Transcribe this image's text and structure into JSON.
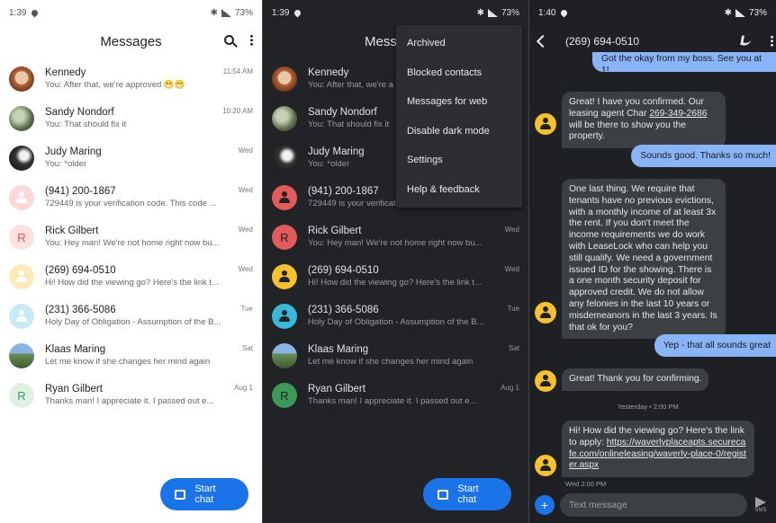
{
  "panel1": {
    "status": {
      "time": "1:39",
      "battery": "73%"
    },
    "title": "Messages",
    "fab_label": "Start chat",
    "conversations": [
      {
        "name": "Kennedy",
        "snippet": "You: After that, we're approved 😁😁",
        "time": "11:54 AM",
        "avatar": "photo1"
      },
      {
        "name": "Sandy Nondorf",
        "snippet": "You: That should fix it",
        "time": "10:20 AM",
        "avatar": "photo2"
      },
      {
        "name": "Judy Maring",
        "snippet": "You: *older",
        "time": "Wed",
        "avatar": "photo3"
      },
      {
        "name": "(941) 200-1867",
        "snippet": "729449 is your verification code. This code ...",
        "time": "Wed",
        "avatar": "person-red"
      },
      {
        "name": "Rick Gilbert",
        "snippet": "You: Hey man! We're not home right now bu...",
        "time": "Wed",
        "avatar": "letter-R-red",
        "letter": "R"
      },
      {
        "name": "(269) 694-0510",
        "snippet": "Hi! How did the viewing go? Here's the link t...",
        "time": "Wed",
        "avatar": "person-yellow"
      },
      {
        "name": "(231) 366-5086",
        "snippet": "Holy Day of Obligation - Assumption of the B...",
        "time": "Tue",
        "avatar": "person-cyan"
      },
      {
        "name": "Klaas Maring",
        "snippet": "Let me know if she changes her mind again",
        "time": "Sat",
        "avatar": "photo4"
      },
      {
        "name": "Ryan Gilbert",
        "snippet": "Thanks man! I appreciate it. I passed out e...",
        "time": "Aug 1",
        "avatar": "letter-R-green",
        "letter": "R"
      }
    ]
  },
  "panel2": {
    "status": {
      "time": "1:39",
      "battery": "73%"
    },
    "title": "Messa",
    "fab_label": "Start chat",
    "menu": [
      "Archived",
      "Blocked contacts",
      "Messages for web",
      "Disable dark mode",
      "Settings",
      "Help & feedback"
    ],
    "conversations": [
      {
        "name": "Kennedy",
        "snippet": "You: After that, we're a",
        "time": ""
      },
      {
        "name": "Sandy Nondorf",
        "snippet": "You: That should fix it",
        "time": ""
      },
      {
        "name": "Judy Maring",
        "snippet": "You: *older",
        "time": ""
      },
      {
        "name": "(941) 200-1867",
        "snippet": "729449 is your verification code. This code ...",
        "time": ""
      },
      {
        "name": "Rick Gilbert",
        "snippet": "You: Hey man! We're not home right now bu...",
        "time": "Wed",
        "letter": "R"
      },
      {
        "name": "(269) 694-0510",
        "snippet": "Hi! How did the viewing go? Here's the link t...",
        "time": "Wed"
      },
      {
        "name": "(231) 366-5086",
        "snippet": "Holy Day of Obligation - Assumption of the B...",
        "time": "Tue"
      },
      {
        "name": "Klaas Maring",
        "snippet": "Let me know if she changes her mind again",
        "time": "Sat"
      },
      {
        "name": "Ryan Gilbert",
        "snippet": "Thanks man! I appreciate it. I passed out e...",
        "time": "Aug 1",
        "letter": "R"
      }
    ]
  },
  "panel3": {
    "status": {
      "time": "1:40",
      "battery": "73%"
    },
    "contact": "(269) 694-0510",
    "messages": {
      "top_partial": "Got the okay from my boss. See you at 1!",
      "m1_a": "Great! I have you confirmed. Our leasing agent Char ",
      "m1_link": "269-349-2686",
      "m1_b": " will be there to show you the property.",
      "m2": "Sounds good. Thanks so much!",
      "m3": "One last thing. We require that tenants have no previous evictions, with a monthly income of at least 3x the rent. If you don't meet the income requirements we do work with LeaseLock who can help you still qualify. We need a government issued ID for the showing. There is a one month security deposit for approved credit. We do not allow any felonies in the last 10 years or misdemeanors in the last 3 years. Is that ok for you?",
      "m4": "Yep - that all sounds great",
      "m5": "Great! Thank you for confirming.",
      "stamp1": "Yesterday • 2:00 PM",
      "m6_a": "Hi! How did the viewing go? Here's the link to apply: ",
      "m6_link": "https://waverlyplaceapts.securecafe.com/onlineleasing/waverly-place-0/register.aspx",
      "stamp2": "Wed 2:00 PM"
    },
    "compose_placeholder": "Text message",
    "send_label": "SMS"
  }
}
